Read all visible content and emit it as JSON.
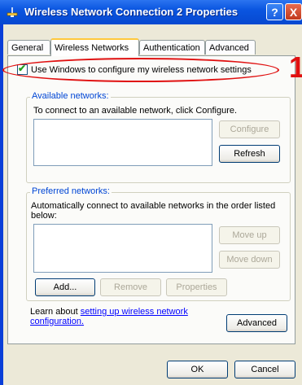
{
  "window": {
    "title": "Wireless Network Connection 2 Properties",
    "help_label": "?",
    "close_label": "X"
  },
  "tabs": [
    {
      "label": "General"
    },
    {
      "label": "Wireless Networks"
    },
    {
      "label": "Authentication"
    },
    {
      "label": "Advanced"
    }
  ],
  "use_windows": {
    "label": "Use Windows to configure my wireless network settings",
    "checked": true
  },
  "annotation": {
    "number": "1",
    "color": "#e01010"
  },
  "available": {
    "title": "Available networks:",
    "description": "To connect to an available network, click Configure.",
    "configure_label": "Configure",
    "refresh_label": "Refresh"
  },
  "preferred": {
    "title": "Preferred networks:",
    "description_line1": "Automatically connect to available networks in the order listed",
    "description_line2": "below:",
    "move_up_label": "Move up",
    "move_down_label": "Move down",
    "add_label": "Add...",
    "remove_label": "Remove",
    "properties_label": "Properties"
  },
  "learn": {
    "prefix": "Learn about ",
    "link_line1": "setting up wireless network",
    "link_line2": "configuration.",
    "advanced_label": "Advanced"
  },
  "footer": {
    "ok_label": "OK",
    "cancel_label": "Cancel"
  }
}
